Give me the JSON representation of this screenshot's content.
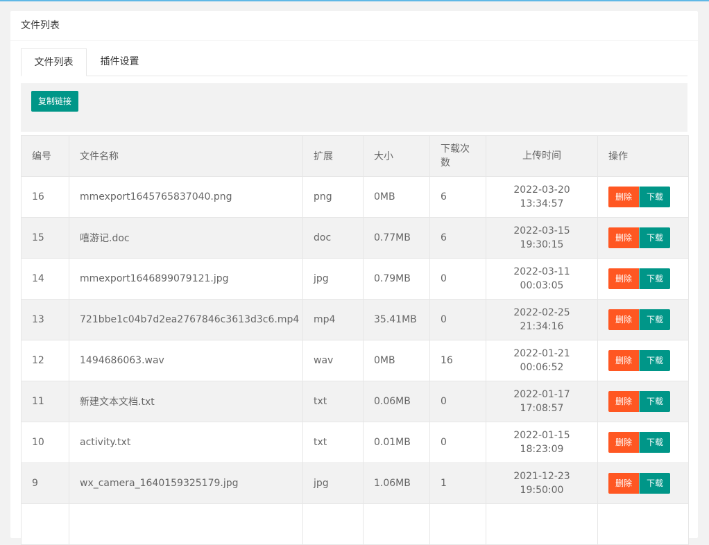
{
  "card": {
    "title": "文件列表"
  },
  "tabs": [
    {
      "label": "文件列表"
    },
    {
      "label": "插件设置"
    }
  ],
  "toolbar": {
    "copy_link_label": "复制链接"
  },
  "table": {
    "headers": {
      "id": "编号",
      "name": "文件名称",
      "ext": "扩展",
      "size": "大小",
      "downloads": "下载次数",
      "uploaded": "上传时间",
      "ops": "操作"
    },
    "delete_label": "删除",
    "download_label": "下载",
    "rows": [
      {
        "id": "16",
        "name": "mmexport1645765837040.png",
        "ext": "png",
        "size": "0MB",
        "downloads": "6",
        "date": "2022-03-20",
        "time": "13:34:57"
      },
      {
        "id": "15",
        "name": "嘻游记.doc",
        "ext": "doc",
        "size": "0.77MB",
        "downloads": "6",
        "date": "2022-03-15",
        "time": "19:30:15"
      },
      {
        "id": "14",
        "name": "mmexport1646899079121.jpg",
        "ext": "jpg",
        "size": "0.79MB",
        "downloads": "0",
        "date": "2022-03-11",
        "time": "00:03:05"
      },
      {
        "id": "13",
        "name": "721bbe1c04b7d2ea2767846c3613d3c6.mp4",
        "ext": "mp4",
        "size": "35.41MB",
        "downloads": "0",
        "date": "2022-02-25",
        "time": "21:34:16"
      },
      {
        "id": "12",
        "name": "1494686063.wav",
        "ext": "wav",
        "size": "0MB",
        "downloads": "16",
        "date": "2022-01-21",
        "time": "00:06:52"
      },
      {
        "id": "11",
        "name": "新建文本文档.txt",
        "ext": "txt",
        "size": "0.06MB",
        "downloads": "0",
        "date": "2022-01-17",
        "time": "17:08:57"
      },
      {
        "id": "10",
        "name": "activity.txt",
        "ext": "txt",
        "size": "0.01MB",
        "downloads": "0",
        "date": "2022-01-15",
        "time": "18:23:09"
      },
      {
        "id": "9",
        "name": "wx_camera_1640159325179.jpg",
        "ext": "jpg",
        "size": "1.06MB",
        "downloads": "1",
        "date": "2021-12-23",
        "time": "19:50:00"
      },
      {
        "id": "",
        "name": "",
        "ext": "",
        "size": "",
        "downloads": "",
        "date": "",
        "time": ""
      }
    ]
  },
  "colors": {
    "primary": "#009688",
    "danger": "#ff5722",
    "top_line": "#5fb8e6",
    "background": "#f2f2f2"
  }
}
